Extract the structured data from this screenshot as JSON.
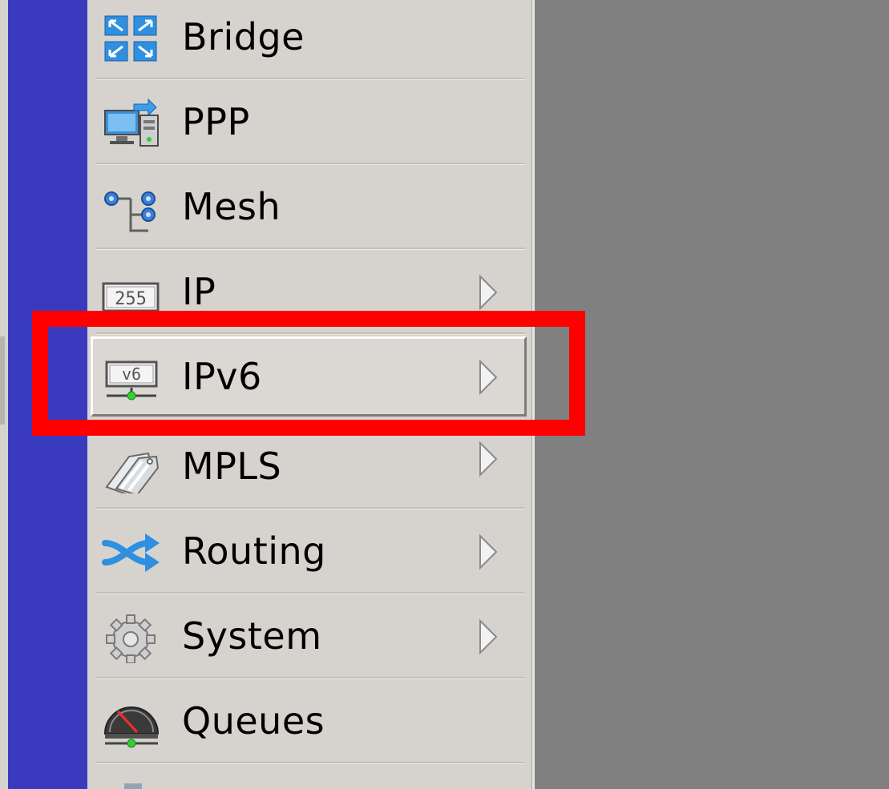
{
  "menu": {
    "items": [
      {
        "label": "Bridge",
        "icon": "bridge-icon",
        "has_submenu": false
      },
      {
        "label": "PPP",
        "icon": "ppp-icon",
        "has_submenu": false
      },
      {
        "label": "Mesh",
        "icon": "mesh-icon",
        "has_submenu": false
      },
      {
        "label": "IP",
        "icon": "ip-icon",
        "has_submenu": true
      },
      {
        "label": "IPv6",
        "icon": "ipv6-icon",
        "has_submenu": true,
        "selected": true
      },
      {
        "label": "MPLS",
        "icon": "mpls-icon",
        "has_submenu": true
      },
      {
        "label": "Routing",
        "icon": "routing-icon",
        "has_submenu": true
      },
      {
        "label": "System",
        "icon": "system-icon",
        "has_submenu": true
      },
      {
        "label": "Queues",
        "icon": "queues-icon",
        "has_submenu": false
      }
    ]
  },
  "icon_text": {
    "ip": "255",
    "ipv6": "v6"
  },
  "colors": {
    "sidebar_strip": "#3a3abf",
    "menu_background": "#d6d3ce",
    "workspace": "#808080",
    "highlight_box": "#ff0000"
  }
}
